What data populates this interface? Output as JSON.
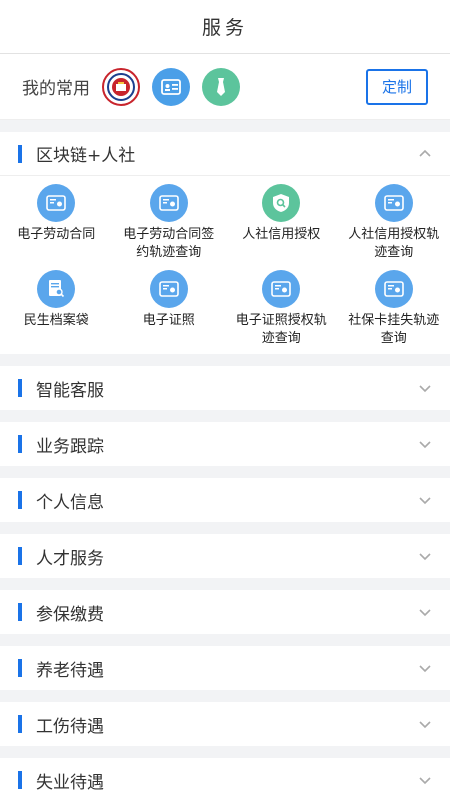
{
  "header": {
    "title": "服务"
  },
  "favorites": {
    "label": "我的常用",
    "custom_label": "定制",
    "icons": [
      "social-security-seal-icon",
      "id-card-icon",
      "badge-tie-icon"
    ]
  },
  "blockchain": {
    "title": "区块链+人社",
    "items": [
      {
        "label": "电子劳动合同",
        "icon": "contract-card-icon",
        "color": "blue"
      },
      {
        "label": "电子劳动合同签约轨迹查询",
        "icon": "contract-card-icon",
        "color": "blue"
      },
      {
        "label": "人社信用授权",
        "icon": "shield-search-icon",
        "color": "green"
      },
      {
        "label": "人社信用授权轨迹查询",
        "icon": "contract-card-icon",
        "color": "blue"
      },
      {
        "label": "民生档案袋",
        "icon": "document-search-icon",
        "color": "blue"
      },
      {
        "label": "电子证照",
        "icon": "contract-card-icon",
        "color": "blue"
      },
      {
        "label": "电子证照授权轨迹查询",
        "icon": "contract-card-icon",
        "color": "blue"
      },
      {
        "label": "社保卡挂失轨迹查询",
        "icon": "contract-card-icon",
        "color": "blue"
      }
    ]
  },
  "sections": [
    {
      "title": "智能客服"
    },
    {
      "title": "业务跟踪"
    },
    {
      "title": "个人信息"
    },
    {
      "title": "人才服务"
    },
    {
      "title": "参保缴费"
    },
    {
      "title": "养老待遇"
    },
    {
      "title": "工伤待遇"
    },
    {
      "title": "失业待遇"
    }
  ],
  "colors": {
    "accent": "#1a73e8",
    "icon_blue": "#5aa6ec",
    "icon_green": "#5cc49c",
    "seal_red": "#c8242c"
  }
}
